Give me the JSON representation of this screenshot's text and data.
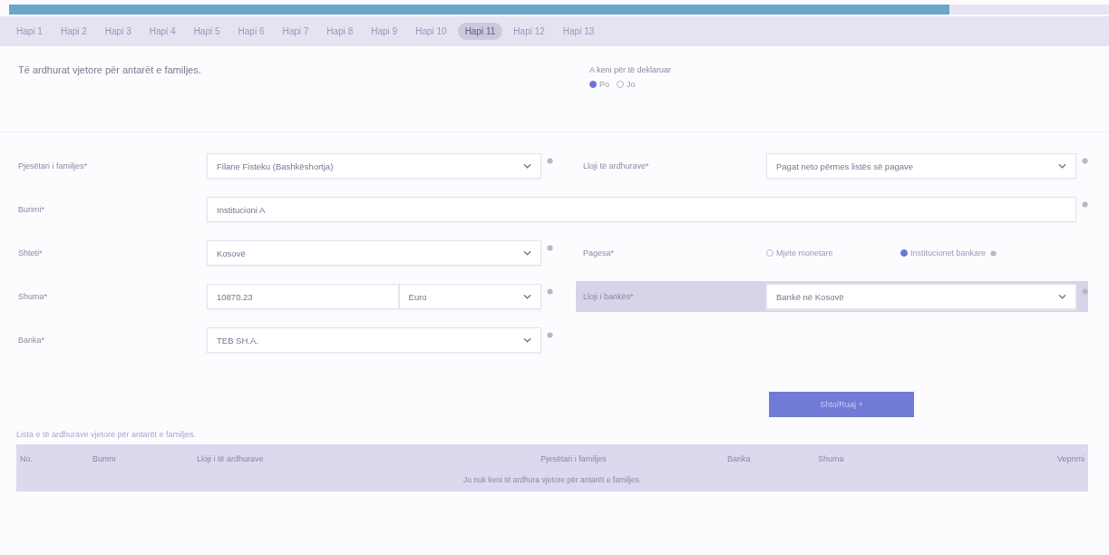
{
  "progress": {
    "level": 0.855
  },
  "tabs": [
    {
      "label": "Hapi 1",
      "selected": false
    },
    {
      "label": "Hapi 2",
      "selected": false
    },
    {
      "label": "Hapi 3",
      "selected": false
    },
    {
      "label": "Hapi 4",
      "selected": false
    },
    {
      "label": "Hapi 5",
      "selected": false
    },
    {
      "label": "Hapi 6",
      "selected": false
    },
    {
      "label": "Hapi 7",
      "selected": false
    },
    {
      "label": "Hapi 8",
      "selected": false
    },
    {
      "label": "Hapi 9",
      "selected": false
    },
    {
      "label": "Hapi 10",
      "selected": false
    },
    {
      "label": "Hapi 11",
      "selected": true
    },
    {
      "label": "Hapi 12",
      "selected": false
    },
    {
      "label": "Hapi 13",
      "selected": false
    }
  ],
  "heading": "Të ardhurat vjetore për antarët e familjes.",
  "declare": {
    "label": "A keni për të deklaruar",
    "options": [
      {
        "label": "Po",
        "selected": true
      },
      {
        "label": "Jo",
        "selected": false
      }
    ]
  },
  "form_rows": [
    [
      {
        "kind": "select",
        "label": "Pjesëtari i familjes*",
        "value": "Filane Fisteku (Bashkëshortja)"
      },
      {
        "kind": "select",
        "label": "Lloji të ardhurave*",
        "value": "Pagat neto përmes listës së pagave"
      }
    ],
    [
      {
        "kind": "text",
        "label": "Burimi*",
        "value": "Institucioni A"
      }
    ],
    [
      {
        "kind": "select",
        "label": "Shteti*",
        "value": "Kosovë"
      },
      {
        "kind": "radio",
        "label": "Pagesa*",
        "options": [
          {
            "label": "Mjete monetare",
            "selected": false
          },
          {
            "label": "Institucionet bankare",
            "selected": true
          }
        ]
      }
    ],
    [
      {
        "kind": "amount",
        "label": "Shuma*",
        "value": "10870.23",
        "currency": "Euro"
      },
      {
        "kind": "select",
        "label": "Lloji i bankës*",
        "value": "Bankë në Kosovë",
        "highlighted": true
      }
    ],
    [
      {
        "kind": "select",
        "label": "Banka*",
        "value": "TEB SH.A."
      }
    ]
  ],
  "add_button": "Shto/Ruaj +",
  "list_title": "Lista e të ardhurave vjetore për antarët e familjes.",
  "table": {
    "columns": [
      "No.",
      "Burimi",
      "Lloji i të ardhurave",
      "Pjesëtari i familjes",
      "Banka",
      "Shuma",
      "Veprimi"
    ],
    "empty_message": "Ju nuk keni të ardhura vjetore për antarët e familjes."
  }
}
